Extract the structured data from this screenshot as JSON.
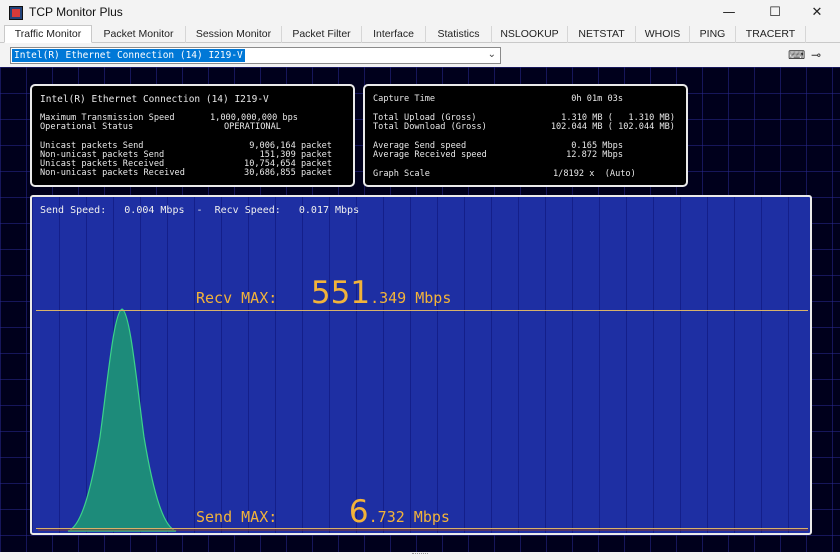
{
  "window": {
    "title": "TCP Monitor Plus",
    "minimize": "—",
    "maximize": "☐",
    "close": "✕"
  },
  "tabs": [
    {
      "label": "Traffic Monitor"
    },
    {
      "label": "Packet Monitor"
    },
    {
      "label": "Session Monitor"
    },
    {
      "label": "Packet Filter"
    },
    {
      "label": "Interface"
    },
    {
      "label": "Statistics"
    },
    {
      "label": "NSLOOKUP"
    },
    {
      "label": "NETSTAT"
    },
    {
      "label": "WHOIS"
    },
    {
      "label": "PING"
    },
    {
      "label": "TRACERT"
    }
  ],
  "toolbar": {
    "adapter": "Intel(R) Ethernet Connection (14) I219-V",
    "icons": [
      "keyboard-icon",
      "pin-icon"
    ]
  },
  "info_left": {
    "adapter_name": "Intel(R) Ethernet Connection (14) I219-V",
    "rows": [
      {
        "key": "Maximum Transmission Speed",
        "value": "1,000,000,000 bps"
      },
      {
        "key": "Operational Status",
        "value": "OPERATIONAL"
      },
      {
        "key": "Unicast packets Send",
        "value": "9,006,164 packet"
      },
      {
        "key": "Non-unicast packets Send",
        "value": "151,309 packet"
      },
      {
        "key": "Unicast packets Received",
        "value": "10,754,654 packet"
      },
      {
        "key": "Non-unicast packets Received",
        "value": "30,686,855 packet"
      }
    ]
  },
  "info_right": {
    "rows": [
      {
        "key": "Capture Time",
        "value": "0h 01m 03s"
      },
      {
        "key": "Total Upload   (Gross)",
        "value": "1.310 MB (   1.310 MB)"
      },
      {
        "key": "Total Download  (Gross)",
        "value": "102.044 MB ( 102.044 MB)"
      },
      {
        "key": "Average Send speed",
        "value": "0.165 Mbps"
      },
      {
        "key": "Average Received speed",
        "value": "12.872 Mbps"
      },
      {
        "key": "Graph Scale",
        "value": "1/8192 x  (Auto)"
      }
    ]
  },
  "graph": {
    "speed_text": "Send Speed:   0.004 Mbps  -  Recv Speed:   0.017 Mbps",
    "recv_max": {
      "label": "Recv MAX:",
      "int": "551",
      "dec": ".349 Mbps"
    },
    "send_max": {
      "label": "Send MAX:",
      "int": "6",
      "dec": ".732 Mbps"
    },
    "colors": {
      "background": "#1e2fa3",
      "recv_fill": "#1d8b7a",
      "recv_stroke": "#3cd38a",
      "max_line": "#d9b26a",
      "max_text": "#f2b33a"
    }
  }
}
